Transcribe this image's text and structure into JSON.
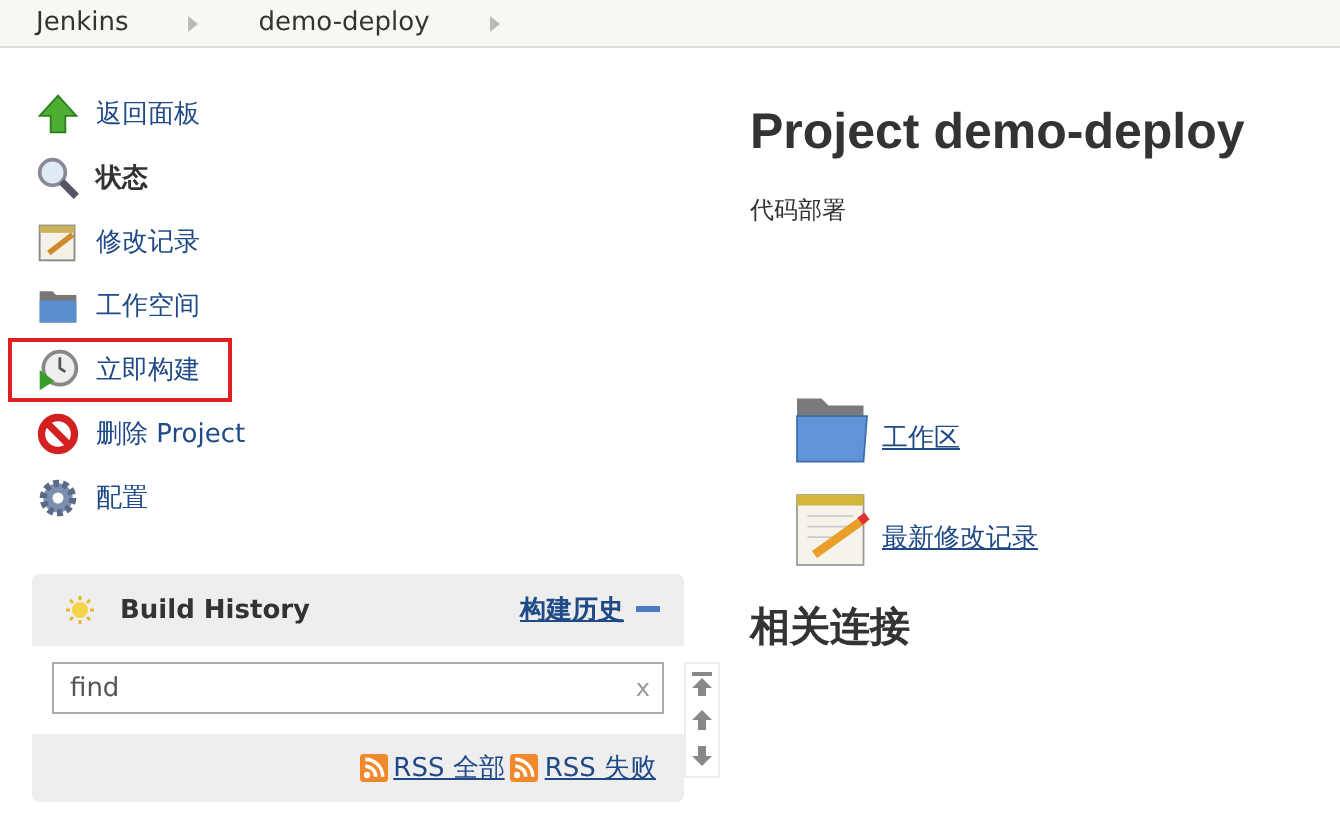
{
  "breadcrumbs": [
    "Jenkins",
    "demo-deploy"
  ],
  "sidebar": {
    "items": [
      {
        "label": "返回面板",
        "bold": false,
        "highlighted": false
      },
      {
        "label": "状态",
        "bold": true,
        "highlighted": false
      },
      {
        "label": "修改记录",
        "bold": false,
        "highlighted": false
      },
      {
        "label": "工作空间",
        "bold": false,
        "highlighted": false
      },
      {
        "label": "立即构建",
        "bold": false,
        "highlighted": true
      },
      {
        "label": "删除 Project",
        "bold": false,
        "highlighted": false
      },
      {
        "label": "配置",
        "bold": false,
        "highlighted": false
      }
    ]
  },
  "build_history": {
    "title": "Build History",
    "trend_link": "构建历史",
    "search": {
      "placeholder": "find",
      "clear": "x"
    },
    "feeds": [
      "RSS 全部",
      "RSS 失败"
    ]
  },
  "main": {
    "title": "Project demo-deploy",
    "description": "代码部署",
    "links": [
      "工作区",
      "最新修改记录"
    ],
    "related_heading": "相关连接"
  }
}
